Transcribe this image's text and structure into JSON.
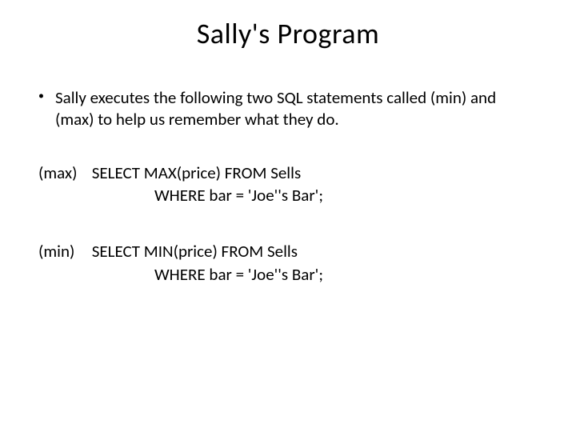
{
  "title": "Sally's Program",
  "bullet": {
    "marker": "•",
    "text": "Sally executes the following two SQL statements called (min) and (max) to help us remember what they do."
  },
  "sql": [
    {
      "label": "(max)",
      "line1": "SELECT MAX(price) FROM Sells",
      "line2": "WHERE bar = 'Joe''s Bar';"
    },
    {
      "label": "(min)",
      "line1": "SELECT MIN(price) FROM Sells",
      "line2": "WHERE bar = 'Joe''s Bar';"
    }
  ]
}
